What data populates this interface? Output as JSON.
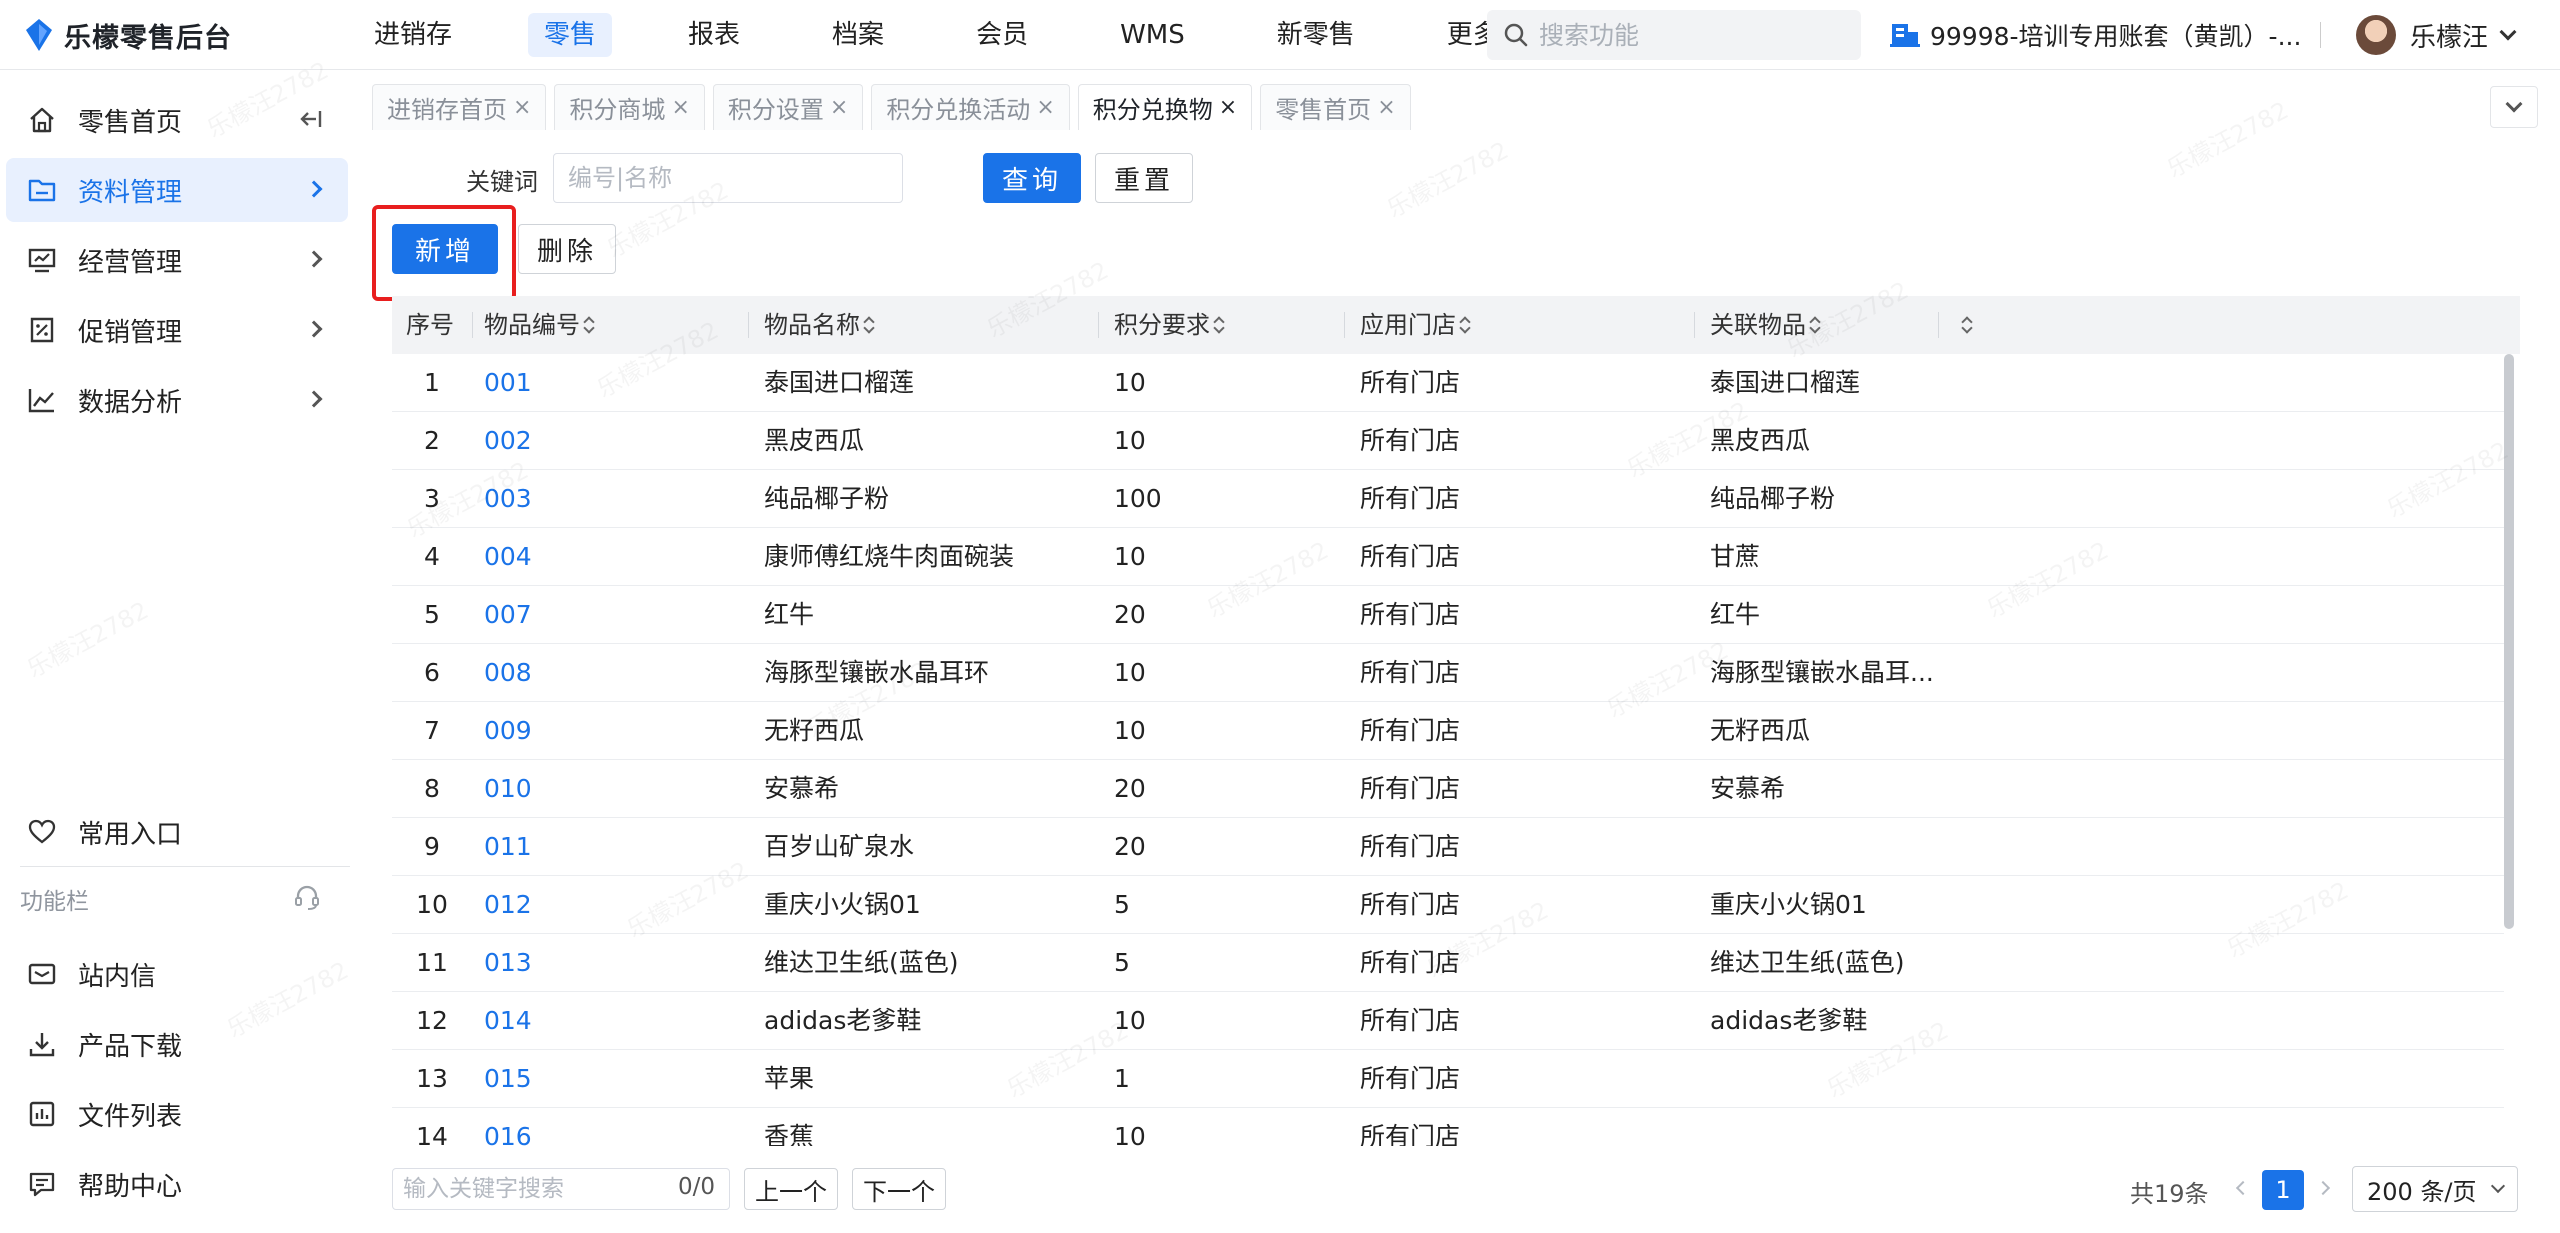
{
  "header": {
    "app_title": "乐檬零售后台",
    "nav": [
      "进销存",
      "零售",
      "报表",
      "档案",
      "会员",
      "WMS",
      "新零售",
      "更多"
    ],
    "search_placeholder": "搜索功能",
    "account": "99998-培训专用账套（黄凯）-...",
    "user_name": "乐檬汪"
  },
  "sidebar": {
    "items": [
      {
        "label": "零售首页",
        "icon": "home-icon"
      },
      {
        "label": "资料管理",
        "icon": "folder-icon"
      },
      {
        "label": "经营管理",
        "icon": "monitor-icon"
      },
      {
        "label": "促销管理",
        "icon": "promotion-icon"
      },
      {
        "label": "数据分析",
        "icon": "chart-icon"
      }
    ],
    "favorites_label": "常用入口",
    "function_bar_label": "功能栏",
    "bottom_items": [
      {
        "label": "站内信",
        "icon": "mail-icon"
      },
      {
        "label": "产品下载",
        "icon": "download-icon"
      },
      {
        "label": "文件列表",
        "icon": "file-list-icon"
      },
      {
        "label": "帮助中心",
        "icon": "help-icon"
      }
    ]
  },
  "tabs": [
    "进销存首页",
    "积分商城",
    "积分设置",
    "积分兑换活动",
    "积分兑换物",
    "零售首页"
  ],
  "active_tab": "积分兑换物",
  "filter": {
    "keyword_label": "关键词",
    "keyword_placeholder": "编号|名称",
    "query_button": "查询",
    "reset_button": "重置"
  },
  "actions": {
    "add_button": "新增",
    "delete_button": "删除"
  },
  "table": {
    "columns": [
      "序号",
      "物品编号",
      "物品名称",
      "积分要求",
      "应用门店",
      "关联物品"
    ],
    "rows": [
      [
        "1",
        "001",
        "泰国进口榴莲",
        "10",
        "所有门店",
        "泰国进口榴莲"
      ],
      [
        "2",
        "002",
        "黑皮西瓜",
        "10",
        "所有门店",
        "黑皮西瓜"
      ],
      [
        "3",
        "003",
        "纯品椰子粉",
        "100",
        "所有门店",
        "纯品椰子粉"
      ],
      [
        "4",
        "004",
        "康师傅红烧牛肉面碗装",
        "10",
        "所有门店",
        "甘蔗"
      ],
      [
        "5",
        "007",
        "红牛",
        "20",
        "所有门店",
        "红牛"
      ],
      [
        "6",
        "008",
        "海豚型镶嵌水晶耳环",
        "10",
        "所有门店",
        "海豚型镶嵌水晶耳..."
      ],
      [
        "7",
        "009",
        "无籽西瓜",
        "10",
        "所有门店",
        "无籽西瓜"
      ],
      [
        "8",
        "010",
        "安慕希",
        "20",
        "所有门店",
        "安慕希"
      ],
      [
        "9",
        "011",
        "百岁山矿泉水",
        "20",
        "所有门店",
        ""
      ],
      [
        "10",
        "012",
        "重庆小火锅01",
        "5",
        "所有门店",
        "重庆小火锅01"
      ],
      [
        "11",
        "013",
        "维达卫生纸(蓝色)",
        "5",
        "所有门店",
        "维达卫生纸(蓝色)"
      ],
      [
        "12",
        "014",
        "adidas老爹鞋",
        "10",
        "所有门店",
        "adidas老爹鞋"
      ],
      [
        "13",
        "015",
        "苹果",
        "1",
        "所有门店",
        ""
      ],
      [
        "14",
        "016",
        "香蕉",
        "10",
        "所有门店",
        ""
      ]
    ]
  },
  "footer": {
    "find_placeholder": "输入关键字搜索",
    "find_count": "0/0",
    "prev_button": "上一个",
    "next_button": "下一个",
    "total": "共19条",
    "current_page": "1",
    "page_size": "200 条/页"
  },
  "watermark": "乐檬汪2782",
  "colors": {
    "accent": "#1a73e8",
    "highlight": "#e81e1e"
  }
}
